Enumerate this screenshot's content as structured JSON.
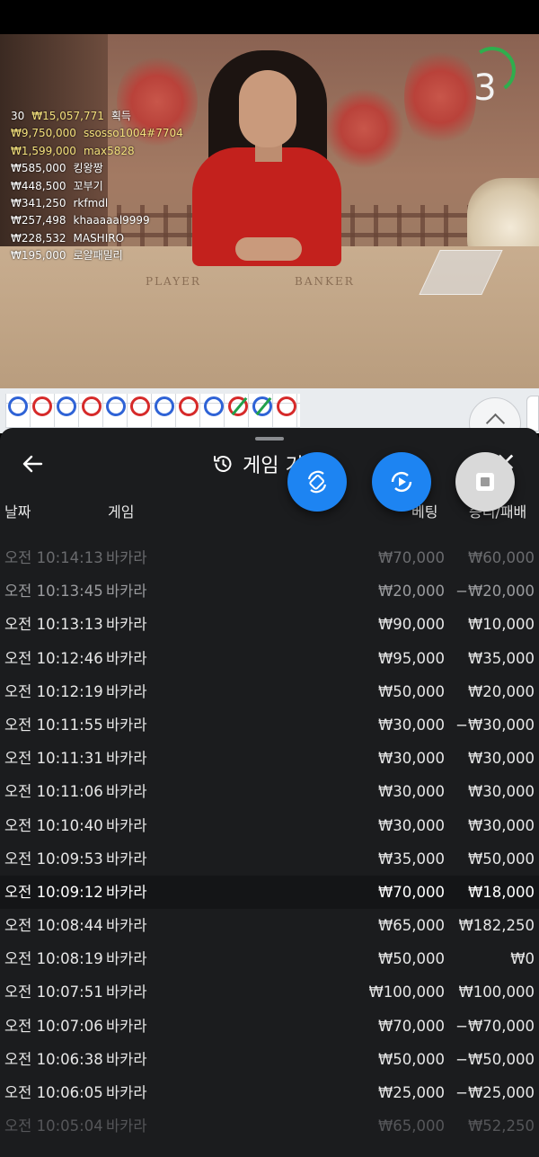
{
  "countdown": "3",
  "winners": {
    "count": "30",
    "total": "₩15,057,771",
    "total_suffix": "획득",
    "list": [
      {
        "amount": "₩9,750,000",
        "name": "ssosso1004#7704"
      },
      {
        "amount": "₩1,599,000",
        "name": "max5828"
      },
      {
        "amount": "₩585,000",
        "name": "킹왕짱"
      },
      {
        "amount": "₩448,500",
        "name": "꼬부기"
      },
      {
        "amount": "₩341,250",
        "name": "rkfmdl"
      },
      {
        "amount": "₩257,498",
        "name": "khaaaaal9999"
      },
      {
        "amount": "₩228,532",
        "name": "MASHIRO"
      },
      {
        "amount": "₩195,000",
        "name": "로얄패밀리"
      }
    ]
  },
  "table_labels": {
    "player": "PLAYER",
    "banker": "BANKER"
  },
  "panel": {
    "title": "게임 기",
    "columns": {
      "date": "날짜",
      "game": "게임",
      "bet": "베팅",
      "result": "승리/패배"
    }
  },
  "history": [
    {
      "time": "오전 10:14:13",
      "game": "바카라",
      "bet": "₩70,000",
      "result": "₩60,000"
    },
    {
      "time": "오전 10:13:45",
      "game": "바카라",
      "bet": "₩20,000",
      "result": "−₩20,000"
    },
    {
      "time": "오전 10:13:13",
      "game": "바카라",
      "bet": "₩90,000",
      "result": "₩10,000"
    },
    {
      "time": "오전 10:12:46",
      "game": "바카라",
      "bet": "₩95,000",
      "result": "₩35,000"
    },
    {
      "time": "오전 10:12:19",
      "game": "바카라",
      "bet": "₩50,000",
      "result": "₩20,000"
    },
    {
      "time": "오전 10:11:55",
      "game": "바카라",
      "bet": "₩30,000",
      "result": "−₩30,000"
    },
    {
      "time": "오전 10:11:31",
      "game": "바카라",
      "bet": "₩30,000",
      "result": "₩30,000"
    },
    {
      "time": "오전 10:11:06",
      "game": "바카라",
      "bet": "₩30,000",
      "result": "₩30,000"
    },
    {
      "time": "오전 10:10:40",
      "game": "바카라",
      "bet": "₩30,000",
      "result": "₩30,000"
    },
    {
      "time": "오전 10:09:53",
      "game": "바카라",
      "bet": "₩35,000",
      "result": "₩50,000"
    },
    {
      "time": "오전 10:09:12",
      "game": "바카라",
      "bet": "₩70,000",
      "result": "₩18,000"
    },
    {
      "time": "오전 10:08:44",
      "game": "바카라",
      "bet": "₩65,000",
      "result": "₩182,250"
    },
    {
      "time": "오전 10:08:19",
      "game": "바카라",
      "bet": "₩50,000",
      "result": "₩0"
    },
    {
      "time": "오전 10:07:51",
      "game": "바카라",
      "bet": "₩100,000",
      "result": "₩100,000"
    },
    {
      "time": "오전 10:07:06",
      "game": "바카라",
      "bet": "₩70,000",
      "result": "−₩70,000"
    },
    {
      "time": "오전 10:06:38",
      "game": "바카라",
      "bet": "₩50,000",
      "result": "−₩50,000"
    },
    {
      "time": "오전 10:06:05",
      "game": "바카라",
      "bet": "₩25,000",
      "result": "−₩25,000"
    },
    {
      "time": "오전 10:05:04",
      "game": "바카라",
      "bet": "₩65,000",
      "result": "₩52,250"
    }
  ],
  "roadmap": [
    "blue",
    "red",
    "blue",
    "red",
    "blue",
    "red",
    "blue",
    "red",
    "blue",
    "tie-red",
    "tie-blue",
    "red"
  ],
  "colors": {
    "accent_blue": "#1d84f2",
    "panel_bg": "#1b1c1e",
    "timer_green": "#2fae4d",
    "winner_gold": "#f5e27d"
  },
  "icons": {
    "back": "arrow-left-icon",
    "history": "history-icon",
    "close": "close-icon",
    "rotate": "rotate-screen-icon",
    "replay": "replay-icon",
    "stop": "stop-icon",
    "scroll_up": "chevron-up-icon"
  }
}
